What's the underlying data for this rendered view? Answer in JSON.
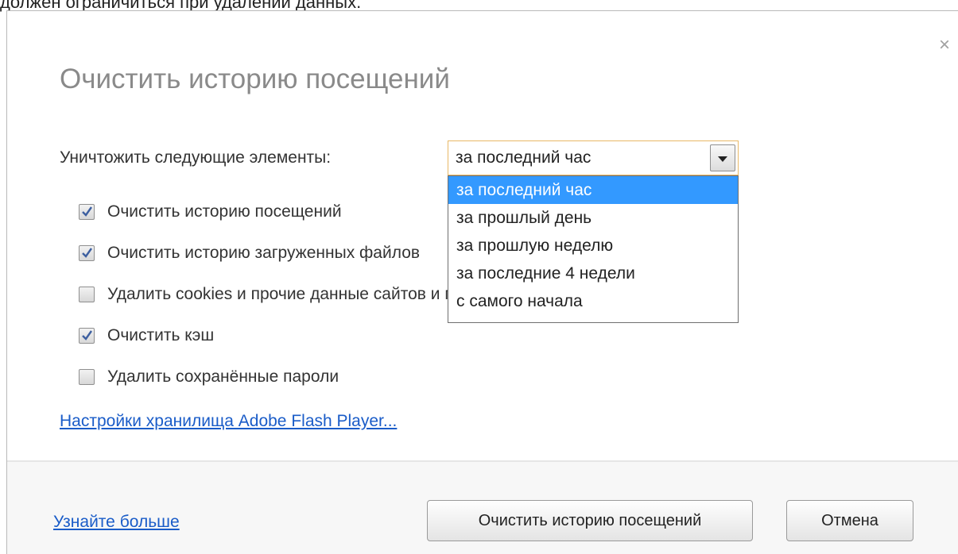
{
  "background": {
    "top_text": "должен ограничиться при удалении данных."
  },
  "dialog": {
    "title": "Очистить историю посещений",
    "close_symbol": "×",
    "period": {
      "label": "Уничтожить следующие элементы:",
      "selected": "за последний час",
      "options": [
        "за последний час",
        "за прошлый день",
        "за прошлую неделю",
        "за последние 4 недели",
        "с самого начала"
      ]
    },
    "checkboxes": [
      {
        "label": "Очистить историю посещений",
        "checked": true
      },
      {
        "label": "Очистить историю загруженных файлов",
        "checked": true
      },
      {
        "label": "Удалить cookies и прочие данные сайтов и плагинов",
        "checked": false
      },
      {
        "label": "Очистить кэш",
        "checked": true
      },
      {
        "label": "Удалить сохранённые пароли",
        "checked": false
      }
    ],
    "flash_link": "Настройки хранилища Adobe Flash Player...",
    "footer": {
      "learn_more": "Узнайте больше",
      "clear_button": "Очистить историю посещений",
      "cancel_button": "Отмена"
    }
  },
  "colors": {
    "link": "#1a5cc8",
    "selected_option_bg": "#3399ff",
    "select_focus_border": "#e8b866",
    "check_mark": "#3d5fa0"
  }
}
